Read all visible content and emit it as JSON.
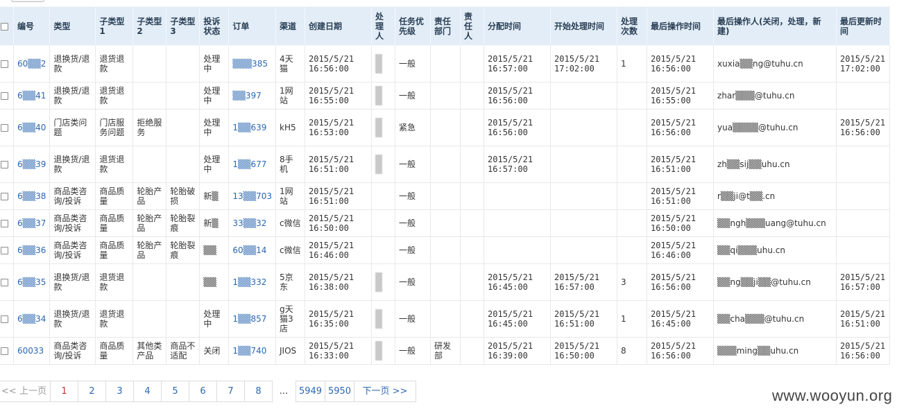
{
  "headers": [
    "",
    "编号",
    "类型",
    "子类型1",
    "子类型2",
    "子类型3",
    "投诉状态",
    "订单",
    "渠道",
    "创建日期",
    "处理人",
    "任务优先级",
    "责任部门",
    "责任人",
    "分配时间",
    "开始处理时间",
    "处理次数",
    "最后操作时间",
    "最后操作人(关闭，处理，新建)",
    "最后更新时间"
  ],
  "rows": [
    [
      "",
      "60▒▒2",
      "退换货/退款",
      "退货退款",
      "",
      "",
      "处理中",
      "▒▒▒385",
      "4天猫",
      "2015/5/21 16:56:00",
      "",
      "一般",
      "",
      "",
      "2015/5/21 16:57:00",
      "2015/5/21 17:02:00",
      "1",
      "2015/5/21 16:56:00",
      "xuxia▒▒ng@tuhu.cn",
      "2015/5/21 17:02:00"
    ],
    [
      "",
      "6▒▒41",
      "退换货/退款",
      "退货退款",
      "",
      "",
      "处理中",
      "▒▒397",
      "1网站",
      "2015/5/21 16:55:00",
      "",
      "一般",
      "",
      "",
      "2015/5/21 16:56:00",
      "",
      "",
      "2015/5/21 16:55:00",
      "zhar▒▒▒@tuhu.cn",
      ""
    ],
    [
      "",
      "6▒▒40",
      "门店类问题",
      "门店服务问题",
      "拒绝服务",
      "",
      "处理中",
      "1▒▒639",
      "kH5",
      "2015/5/21 16:53:00",
      "",
      "紧急",
      "",
      "",
      "2015/5/21 16:56:00",
      "",
      "",
      "2015/5/21 16:56:00",
      "yua▒▒▒▒@tuhu.cn",
      "2015/5/21 16:56:00"
    ],
    [
      "",
      "6▒▒39",
      "退换货/退款",
      "退货退款",
      "",
      "",
      "处理中",
      "1▒▒677",
      "8手机",
      "2015/5/21 16:51:00",
      "",
      "一般",
      "",
      "",
      "2015/5/21 16:57:00",
      "",
      "",
      "2015/5/21 16:51:00",
      "zh▒▒sij▒▒uhu.cn",
      ""
    ],
    [
      "",
      "6▒▒38",
      "商品类咨询/投诉",
      "商品质量",
      "轮胎产品",
      "轮胎破损",
      "新▒",
      "13▒▒703",
      "1网站",
      "2015/5/21 16:51:00",
      "",
      "一般",
      "",
      "",
      "",
      "",
      "",
      "2015/5/21 16:51:00",
      "r▒▒ji@t▒▒.cn",
      ""
    ],
    [
      "",
      "6▒▒37",
      "商品类咨询/投诉",
      "商品质量",
      "轮胎产品",
      "轮胎裂痕",
      "新▒",
      "33▒▒32",
      "c微信",
      "2015/5/21 16:50:00",
      "",
      "一般",
      "",
      "",
      "",
      "",
      "",
      "2015/5/21 16:50:00",
      "▒▒ngh▒▒▒uang@tuhu.cn",
      ""
    ],
    [
      "",
      "6▒▒36",
      "商品类咨询/投诉",
      "商品质量",
      "轮胎产品",
      "轮胎裂痕",
      "▒▒",
      "60▒▒14",
      "c微信",
      "2015/5/21 16:46:00",
      "",
      "一般",
      "",
      "",
      "",
      "",
      "",
      "2015/5/21 16:46:00",
      "▒▒qi▒▒▒uhu.cn",
      ""
    ],
    [
      "",
      "6▒▒35",
      "退换货/退款",
      "退货退款",
      "",
      "",
      "▒▒",
      "1▒▒332",
      "5京东",
      "2015/5/21 16:38:00",
      "",
      "一般",
      "",
      "",
      "2015/5/21 16:45:00",
      "2015/5/21 16:57:00",
      "3",
      "2015/5/21 16:56:00",
      "▒▒ng▒▒ji▒▒@tuhu.cn",
      "2015/5/21 16:57:00"
    ],
    [
      "",
      "6▒▒34",
      "退换货/退款",
      "退货退款",
      "",
      "",
      "处理中",
      "1▒▒857",
      "g天猫3店",
      "2015/5/21 16:35:00",
      "",
      "一般",
      "",
      "",
      "2015/5/21 16:45:00",
      "2015/5/21 16:51:00",
      "1",
      "2015/5/21 16:45:00",
      "▒▒cha▒▒▒@tuhu.cn",
      "2015/5/21 16:51:00"
    ],
    [
      "",
      "60033",
      "商品类咨询/投诉",
      "商品质量",
      "其他类产品",
      "商品不适配",
      "关闭",
      "1▒▒740",
      "JIOS",
      "2015/5/21 16:33:00",
      "",
      "一般",
      "研发部",
      "",
      "2015/5/21 16:39:00",
      "2015/5/21 16:50:00",
      "8",
      "2015/5/21 16:56:00",
      "▒▒▒ming▒▒uhu.cn",
      "2015/5/21 16:56:00"
    ]
  ],
  "pager": {
    "prev": "<< 上一页",
    "pages": [
      "1",
      "2",
      "3",
      "4",
      "5",
      "6",
      "7",
      "8"
    ],
    "dots": "...",
    "tail": [
      "5949",
      "5950"
    ],
    "next": "下一页 >>",
    "current": "1"
  },
  "watermark": "www.wooyun.org",
  "colors": {
    "header_bg": "#e3edf7",
    "link": "#2b67b1",
    "active_page": "#c23232"
  }
}
